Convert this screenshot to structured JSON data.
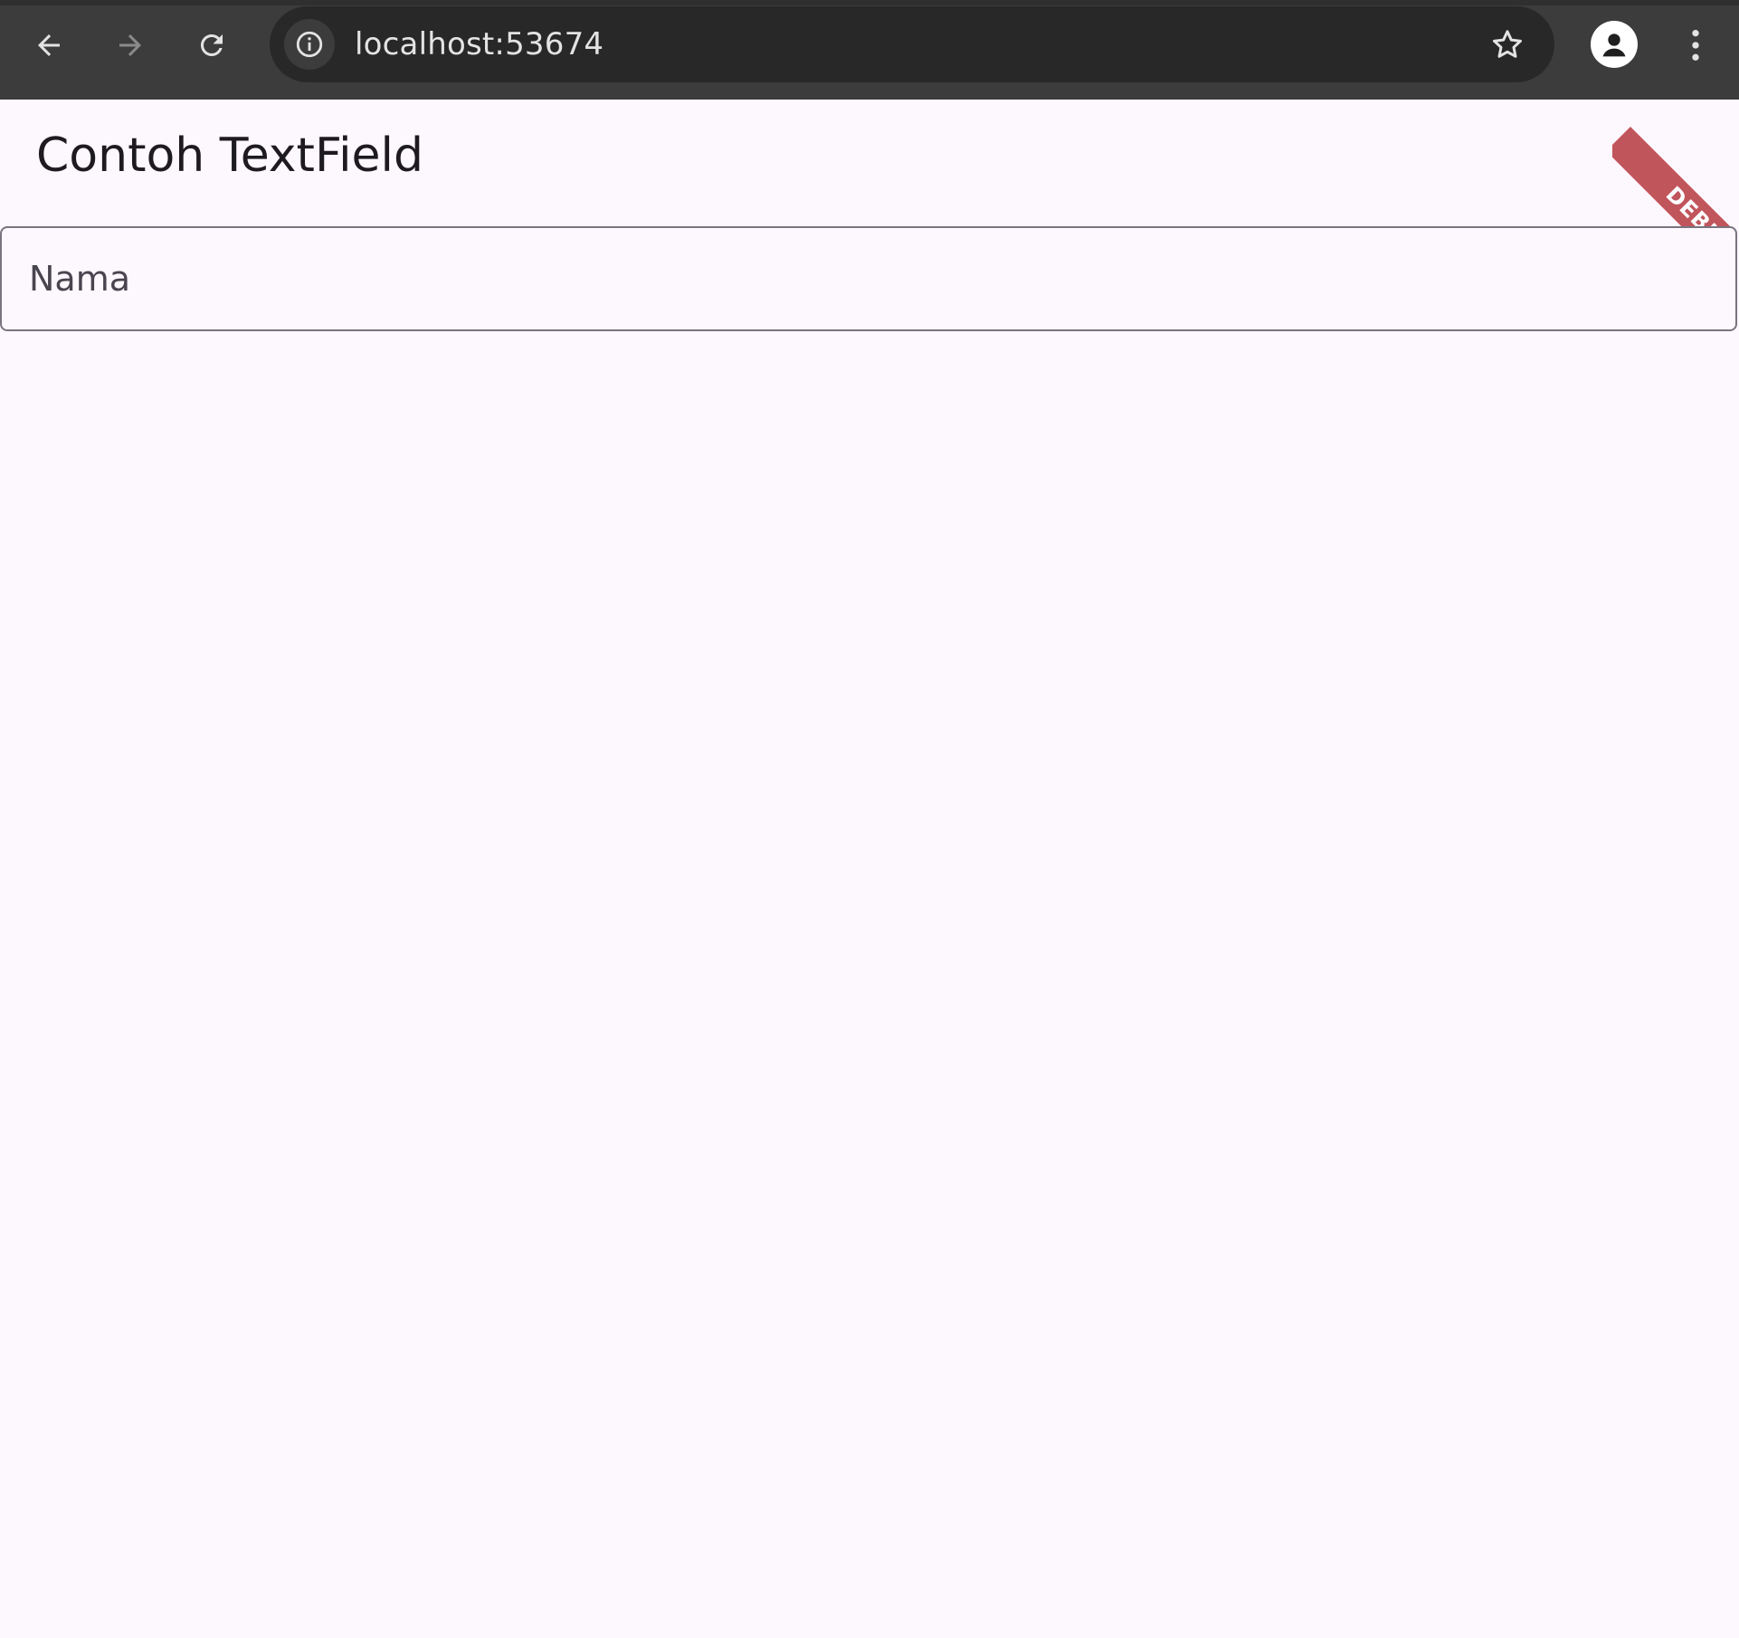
{
  "browser": {
    "url": "localhost:53674",
    "colors": {
      "chrome": "#3c3c3c",
      "omnibox": "#282828",
      "icon": "#e3e3e3",
      "icon_disabled": "#8a8a8a"
    }
  },
  "app": {
    "title": "Contoh TextField",
    "text_field": {
      "label": "Nama",
      "value": ""
    },
    "debug_banner": "DEBUG",
    "colors": {
      "background": "#fdf7fe",
      "title": "#1d1b20",
      "field_border": "#79747e",
      "label": "#49454f",
      "banner": "#b6393f"
    }
  }
}
